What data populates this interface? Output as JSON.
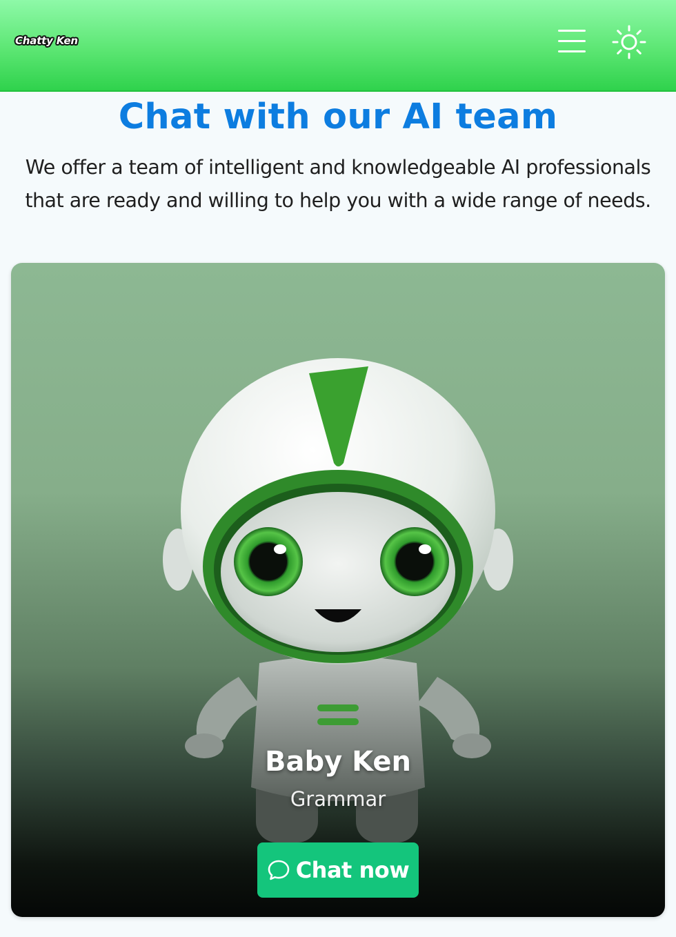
{
  "header": {
    "logo_text": "Chatty Ken",
    "menu_icon": "hamburger-menu-icon",
    "theme_icon": "sun-icon"
  },
  "hero": {
    "title": "Chat with our AI team",
    "subtitle_line1": "We offer a team of intelligent and knowledgeable AI professionals",
    "subtitle_line2": "that are ready and willing to help you with a wide range of needs."
  },
  "card": {
    "image_subject": "cartoon green-and-white robot astronaut",
    "name": "Baby Ken",
    "role": "Grammar",
    "button_label": "Chat now",
    "button_icon": "chat-bubble-icon"
  },
  "colors": {
    "header_green": "#5ce673",
    "title_blue": "#0d7de0",
    "button_green": "#14c57c",
    "page_background": "#f5fafc"
  }
}
